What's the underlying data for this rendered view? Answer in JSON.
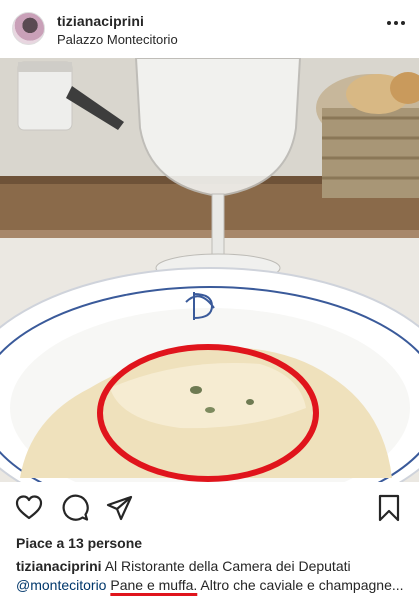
{
  "post": {
    "username": "tizianaciprini",
    "location": "Palazzo Montecitorio",
    "likes": "Piace a 13 persone",
    "caption": {
      "username": "tizianaciprini",
      "text_1": "Al Ristorante della Camera dei Deputati",
      "mention": "@montecitorio",
      "highlight": "Pane e muffa.",
      "text_2": "Altro che caviale e champagne..."
    }
  },
  "icons": {
    "more": "more-options-icon",
    "like": "heart-icon",
    "comment": "comment-icon",
    "share": "share-icon",
    "save": "bookmark-icon"
  },
  "colors": {
    "annotation_circle": "#e0141c",
    "mention": "#00376b",
    "text": "#262626"
  }
}
